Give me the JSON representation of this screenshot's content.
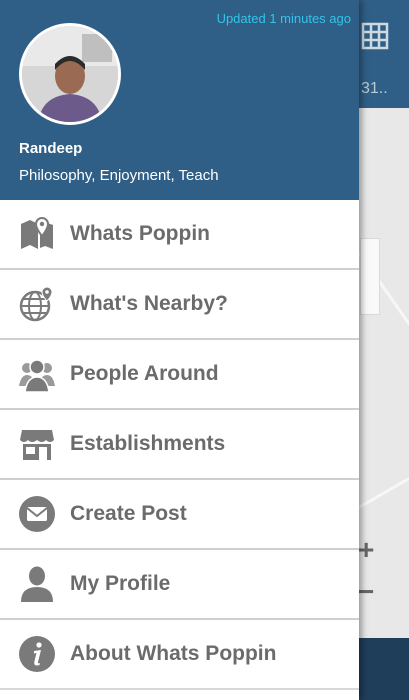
{
  "background": {
    "truncated_count": "31..",
    "zoom_in": "+",
    "zoom_out": "−"
  },
  "drawer": {
    "updated_text": "Updated 1 minutes ago",
    "user": {
      "name": "Randeep",
      "interests": "Philosophy, Enjoyment, Teach"
    },
    "menu": [
      {
        "label": "Whats Poppin",
        "icon": "map-pin-icon"
      },
      {
        "label": "What's Nearby?",
        "icon": "globe-pin-icon"
      },
      {
        "label": "People Around",
        "icon": "people-icon"
      },
      {
        "label": "Establishments",
        "icon": "store-icon"
      },
      {
        "label": "Create Post",
        "icon": "envelope-icon"
      },
      {
        "label": "My Profile",
        "icon": "person-icon"
      },
      {
        "label": "About Whats Poppin",
        "icon": "info-icon"
      }
    ]
  },
  "colors": {
    "header_blue": "#2f5f86",
    "updated_cyan": "#33c3e8",
    "menu_text": "#6b6b6b",
    "icon_gray": "#7a7a7a"
  }
}
